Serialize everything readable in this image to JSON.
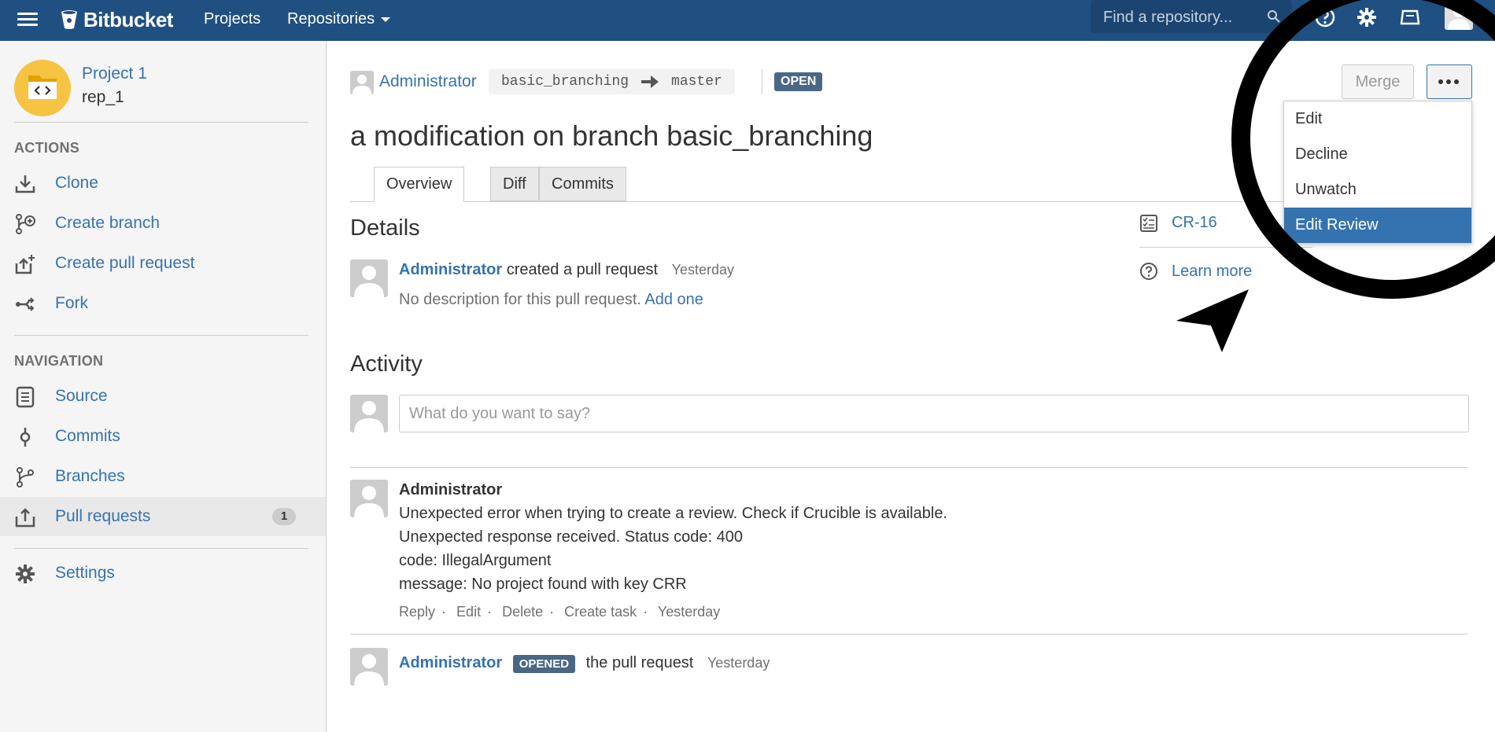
{
  "header": {
    "logo_text": "Bitbucket",
    "nav": {
      "projects": "Projects",
      "repositories": "Repositories"
    },
    "search_placeholder": "Find a repository...",
    "icons": [
      "menu-icon",
      "bitbucket-logo-icon",
      "search-icon",
      "help-icon",
      "gear-icon",
      "notifications-icon",
      "user-avatar"
    ]
  },
  "sidebar": {
    "project_name": "Project 1",
    "repo_name": "rep_1",
    "actions_heading": "ACTIONS",
    "actions": [
      {
        "label": "Clone",
        "icon": "download-icon"
      },
      {
        "label": "Create branch",
        "icon": "branch-add-icon"
      },
      {
        "label": "Create pull request",
        "icon": "pull-request-create-icon"
      },
      {
        "label": "Fork",
        "icon": "fork-icon"
      }
    ],
    "navigation_heading": "NAVIGATION",
    "navigation": [
      {
        "label": "Source",
        "icon": "source-icon"
      },
      {
        "label": "Commits",
        "icon": "commit-icon"
      },
      {
        "label": "Branches",
        "icon": "branches-icon"
      },
      {
        "label": "Pull requests",
        "icon": "pull-request-icon",
        "count": "1"
      }
    ],
    "settings": {
      "label": "Settings",
      "icon": "gear-icon"
    }
  },
  "pr": {
    "author": "Administrator",
    "source_branch": "basic_branching",
    "target_branch": "master",
    "state": "OPEN",
    "title": "a modification on branch basic_branching",
    "merge_label": "Merge",
    "tabs": [
      "Overview",
      "Diff",
      "Commits"
    ],
    "menu": [
      "Edit",
      "Decline",
      "Unwatch",
      "Edit Review"
    ],
    "details_heading": "Details",
    "created_user": "Administrator",
    "created_text": "created a pull request",
    "created_time": "Yesterday",
    "no_description": "No description for this pull request.",
    "add_one": "Add one",
    "review_id": "CR-16",
    "learn_more": "Learn more"
  },
  "activity": {
    "heading": "Activity",
    "comment_placeholder": "What do you want to say?",
    "comment": {
      "author": "Administrator",
      "lines": [
        "Unexpected error when trying to create a review. Check if Crucible is available.",
        "Unexpected response received. Status code: 400",
        "code: IllegalArgument",
        "message: No project found with key CRR"
      ],
      "actions": [
        "Reply",
        "Edit",
        "Delete",
        "Create task"
      ],
      "time": "Yesterday"
    },
    "event": {
      "author": "Administrator",
      "badge": "OPENED",
      "text": "the pull request",
      "time": "Yesterday"
    }
  }
}
